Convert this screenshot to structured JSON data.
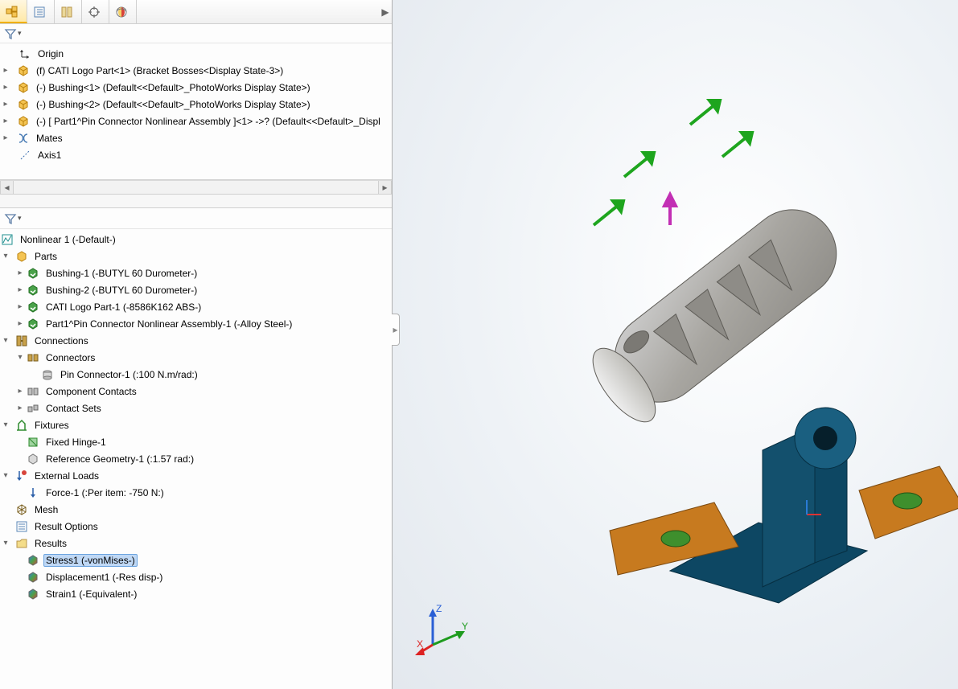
{
  "toolbar_tabs": [
    {
      "name": "assembly-icon"
    },
    {
      "name": "config-list-icon"
    },
    {
      "name": "history-icon"
    },
    {
      "name": "appearance-target-icon"
    },
    {
      "name": "appearances-globe-icon"
    }
  ],
  "feature_tree": {
    "origin": "Origin",
    "items": [
      "(f) CATI Logo Part<1> (Bracket Bosses<Display State-3>)",
      "(-) Bushing<1> (Default<<Default>_PhotoWorks Display State>)",
      "(-) Bushing<2> (Default<<Default>_PhotoWorks Display State>)",
      "(-) [ Part1^Pin Connector Nonlinear Assembly ]<1> ->? (Default<<Default>_Displ"
    ],
    "mates": "Mates",
    "axis": "Axis1"
  },
  "sim_tree": {
    "study": "Nonlinear 1 (-Default-)",
    "parts_label": "Parts",
    "parts": [
      "Bushing-1 (-BUTYL 60 Durometer-)",
      "Bushing-2 (-BUTYL 60 Durometer-)",
      "CATI Logo Part-1 (-8586K162 ABS-)",
      "Part1^Pin Connector Nonlinear Assembly-1 (-Alloy Steel-)"
    ],
    "connections_label": "Connections",
    "connectors_label": "Connectors",
    "connector_item": "Pin Connector-1 (:100 N.m/rad:)",
    "component_contacts": "Component Contacts",
    "contact_sets": "Contact Sets",
    "fixtures_label": "Fixtures",
    "fixture_items": [
      "Fixed Hinge-1",
      "Reference Geometry-1 (:1.57 rad:)"
    ],
    "loads_label": "External Loads",
    "load_item": "Force-1 (:Per item: -750 N:)",
    "mesh": "Mesh",
    "result_options": "Result Options",
    "results_label": "Results",
    "results": [
      "Stress1 (-vonMises-)",
      "Displacement1 (-Res disp-)",
      "Strain1 (-Equivalent-)"
    ],
    "selected_result_index": 0
  },
  "triad": {
    "x": "X",
    "y": "Y",
    "z": "Z"
  }
}
